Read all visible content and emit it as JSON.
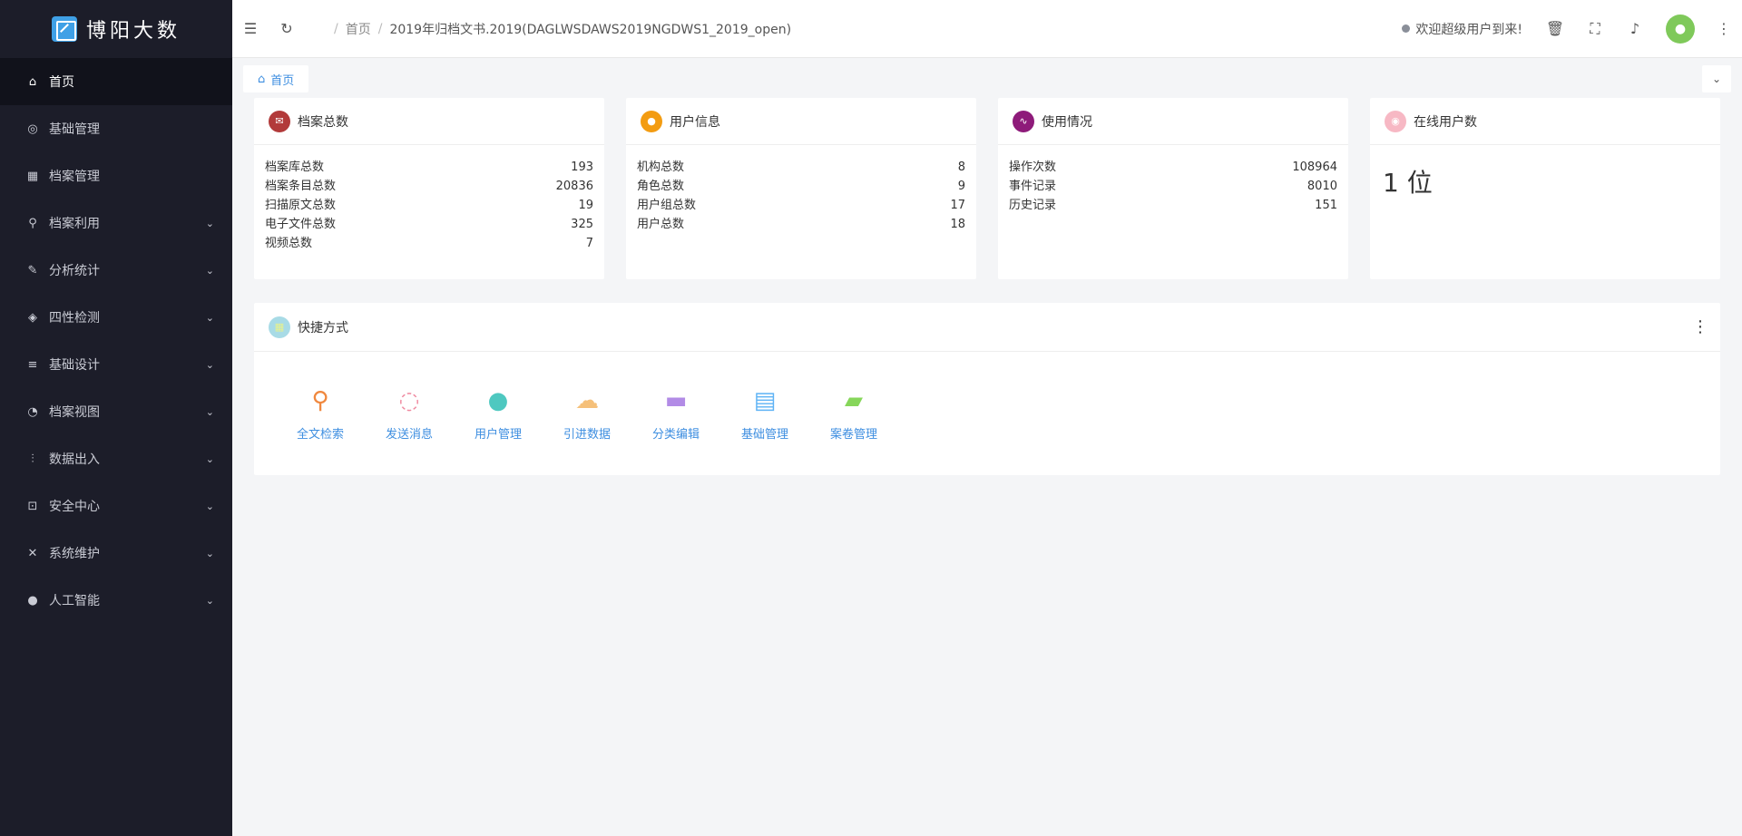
{
  "app": {
    "name": "博阳大数"
  },
  "sidebar": {
    "items": [
      {
        "label": "首页",
        "icon": "home-icon",
        "glyph": "⌂",
        "active": true,
        "expandable": false
      },
      {
        "label": "基础管理",
        "icon": "settings-icon",
        "glyph": "◎",
        "active": false,
        "expandable": false
      },
      {
        "label": "档案管理",
        "icon": "grid-icon",
        "glyph": "▦",
        "active": false,
        "expandable": false
      },
      {
        "label": "档案利用",
        "icon": "search-icon",
        "glyph": "⚲",
        "active": false,
        "expandable": true
      },
      {
        "label": "分析统计",
        "icon": "edit-icon",
        "glyph": "✎",
        "active": false,
        "expandable": true
      },
      {
        "label": "四性检测",
        "icon": "tag-icon",
        "glyph": "◈",
        "active": false,
        "expandable": true
      },
      {
        "label": "基础设计",
        "icon": "list-icon",
        "glyph": "≡",
        "active": false,
        "expandable": true
      },
      {
        "label": "档案视图",
        "icon": "dashboard-icon",
        "glyph": "◔",
        "active": false,
        "expandable": true
      },
      {
        "label": "数据出入",
        "icon": "sliders-icon",
        "glyph": "⫶",
        "active": false,
        "expandable": true
      },
      {
        "label": "安全中心",
        "icon": "lock-icon",
        "glyph": "⊡",
        "active": false,
        "expandable": true
      },
      {
        "label": "系统维护",
        "icon": "tools-icon",
        "glyph": "✕",
        "active": false,
        "expandable": true
      },
      {
        "label": "人工智能",
        "icon": "robot-icon",
        "glyph": "●",
        "active": false,
        "expandable": true
      }
    ]
  },
  "header": {
    "breadcrumb": {
      "home": "首页",
      "current": "2019年归档文书.2019(DAGLWSDAWS2019NGDWS1_2019_open)"
    },
    "welcome": "欢迎超级用户到来!"
  },
  "tabs": {
    "home": "首页"
  },
  "cards": {
    "archives": {
      "title": "档案总数",
      "color": "#c0392b",
      "rows": [
        {
          "label": "档案库总数",
          "value": "193"
        },
        {
          "label": "档案条目总数",
          "value": "20836"
        },
        {
          "label": "扫描原文总数",
          "value": "19"
        },
        {
          "label": "电子文件总数",
          "value": "325"
        },
        {
          "label": "视频总数",
          "value": "7"
        }
      ]
    },
    "users": {
      "title": "用户信息",
      "color": "#f39c12",
      "rows": [
        {
          "label": "机构总数",
          "value": "8"
        },
        {
          "label": "角色总数",
          "value": "9"
        },
        {
          "label": "用户组总数",
          "value": "17"
        },
        {
          "label": "用户总数",
          "value": "18"
        }
      ]
    },
    "usage": {
      "title": "使用情况",
      "color": "#8e1b7a",
      "rows": [
        {
          "label": "操作次数",
          "value": "108964"
        },
        {
          "label": "事件记录",
          "value": "8010"
        },
        {
          "label": "历史记录",
          "value": "151"
        }
      ]
    },
    "online": {
      "title": "在线用户数",
      "color": "#f7b8c4",
      "value": "1 位"
    }
  },
  "quick": {
    "title": "快捷方式",
    "items": [
      {
        "label": "全文检索",
        "icon": "search-icon",
        "glyph": "⚲",
        "color": "#f0883e"
      },
      {
        "label": "发送消息",
        "icon": "message-icon",
        "glyph": "◌",
        "color": "#f08aa0"
      },
      {
        "label": "用户管理",
        "icon": "user-icon",
        "glyph": "●",
        "color": "#4ec8c0"
      },
      {
        "label": "引进数据",
        "icon": "cloud-upload-icon",
        "glyph": "☁",
        "color": "#f5c07a"
      },
      {
        "label": "分类编辑",
        "icon": "folder-stack-icon",
        "glyph": "▬",
        "color": "#b28be6"
      },
      {
        "label": "基础管理",
        "icon": "document-icon",
        "glyph": "▤",
        "color": "#5fb3f5"
      },
      {
        "label": "案卷管理",
        "icon": "folder-icon",
        "glyph": "▰",
        "color": "#86d65a"
      }
    ]
  }
}
